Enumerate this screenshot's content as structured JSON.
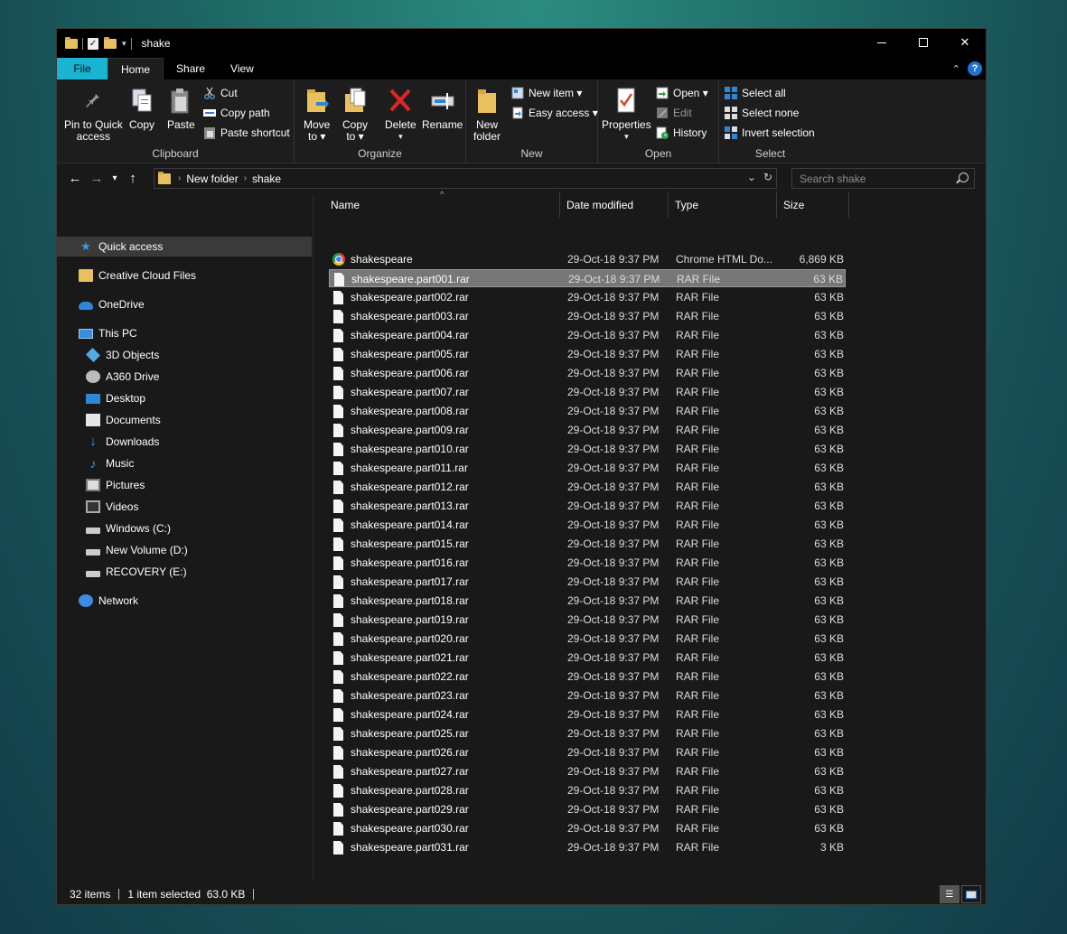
{
  "window": {
    "title": "shake",
    "controls": {
      "minimize": "minimize",
      "maximize": "maximize",
      "close": "✕"
    }
  },
  "ribbon_tabs": [
    {
      "label": "File"
    },
    {
      "label": "Home"
    },
    {
      "label": "Share"
    },
    {
      "label": "View"
    }
  ],
  "ribbon": {
    "clipboard": {
      "label": "Clipboard",
      "pin_line1": "Pin to Quick",
      "pin_line2": "access",
      "copy": "Copy",
      "paste": "Paste",
      "cut": "Cut",
      "copy_path": "Copy path",
      "paste_shortcut": "Paste shortcut"
    },
    "organize": {
      "label": "Organize",
      "move_line1": "Move",
      "move_line2": "to ▾",
      "copyto_line1": "Copy",
      "copyto_line2": "to ▾",
      "delete": "Delete",
      "delete_caret": "▾",
      "rename": "Rename"
    },
    "new": {
      "label": "New",
      "folder_line1": "New",
      "folder_line2": "folder",
      "new_item": "New item ▾",
      "easy_access": "Easy access ▾"
    },
    "open": {
      "label": "Open",
      "properties": "Properties",
      "properties_caret": "▾",
      "open": "Open ▾",
      "edit": "Edit",
      "history": "History"
    },
    "select": {
      "label": "Select",
      "select_all": "Select all",
      "select_none": "Select none",
      "invert": "Invert selection"
    }
  },
  "address": {
    "crumbs": [
      "New folder",
      "shake"
    ],
    "search_placeholder": "Search shake"
  },
  "nav_pane": [
    {
      "label": "Quick access",
      "icon": "star-icon",
      "selected": true
    },
    {
      "label": "Creative Cloud Files",
      "icon": "creative-cloud-icon"
    },
    {
      "label": "OneDrive",
      "icon": "cloud-icon"
    },
    {
      "label": "This PC",
      "icon": "computer-icon"
    },
    {
      "label": "3D Objects",
      "icon": "cube-icon"
    },
    {
      "label": "A360 Drive",
      "icon": "a360-drive-icon"
    },
    {
      "label": "Desktop",
      "icon": "desktop-icon"
    },
    {
      "label": "Documents",
      "icon": "documents-icon"
    },
    {
      "label": "Downloads",
      "icon": "download-arrow-icon"
    },
    {
      "label": "Music",
      "icon": "music-note-icon"
    },
    {
      "label": "Pictures",
      "icon": "pictures-icon"
    },
    {
      "label": "Videos",
      "icon": "videos-icon"
    },
    {
      "label": "Windows (C:)",
      "icon": "drive-icon"
    },
    {
      "label": "New Volume (D:)",
      "icon": "drive-icon"
    },
    {
      "label": "RECOVERY (E:)",
      "icon": "drive-icon"
    },
    {
      "label": "Network",
      "icon": "network-icon"
    }
  ],
  "columns": {
    "name": "Name",
    "date": "Date modified",
    "type": "Type",
    "size": "Size"
  },
  "files": [
    {
      "name": "shakespeare",
      "date": "29-Oct-18 9:37 PM",
      "type": "Chrome HTML Do...",
      "size": "6,869 KB",
      "icon": "chrome-icon"
    },
    {
      "name": "shakespeare.part001.rar",
      "date": "29-Oct-18 9:37 PM",
      "type": "RAR File",
      "size": "63 KB",
      "selected": true
    },
    {
      "name": "shakespeare.part002.rar",
      "date": "29-Oct-18 9:37 PM",
      "type": "RAR File",
      "size": "63 KB"
    },
    {
      "name": "shakespeare.part003.rar",
      "date": "29-Oct-18 9:37 PM",
      "type": "RAR File",
      "size": "63 KB"
    },
    {
      "name": "shakespeare.part004.rar",
      "date": "29-Oct-18 9:37 PM",
      "type": "RAR File",
      "size": "63 KB"
    },
    {
      "name": "shakespeare.part005.rar",
      "date": "29-Oct-18 9:37 PM",
      "type": "RAR File",
      "size": "63 KB"
    },
    {
      "name": "shakespeare.part006.rar",
      "date": "29-Oct-18 9:37 PM",
      "type": "RAR File",
      "size": "63 KB"
    },
    {
      "name": "shakespeare.part007.rar",
      "date": "29-Oct-18 9:37 PM",
      "type": "RAR File",
      "size": "63 KB"
    },
    {
      "name": "shakespeare.part008.rar",
      "date": "29-Oct-18 9:37 PM",
      "type": "RAR File",
      "size": "63 KB"
    },
    {
      "name": "shakespeare.part009.rar",
      "date": "29-Oct-18 9:37 PM",
      "type": "RAR File",
      "size": "63 KB"
    },
    {
      "name": "shakespeare.part010.rar",
      "date": "29-Oct-18 9:37 PM",
      "type": "RAR File",
      "size": "63 KB"
    },
    {
      "name": "shakespeare.part011.rar",
      "date": "29-Oct-18 9:37 PM",
      "type": "RAR File",
      "size": "63 KB"
    },
    {
      "name": "shakespeare.part012.rar",
      "date": "29-Oct-18 9:37 PM",
      "type": "RAR File",
      "size": "63 KB"
    },
    {
      "name": "shakespeare.part013.rar",
      "date": "29-Oct-18 9:37 PM",
      "type": "RAR File",
      "size": "63 KB"
    },
    {
      "name": "shakespeare.part014.rar",
      "date": "29-Oct-18 9:37 PM",
      "type": "RAR File",
      "size": "63 KB"
    },
    {
      "name": "shakespeare.part015.rar",
      "date": "29-Oct-18 9:37 PM",
      "type": "RAR File",
      "size": "63 KB"
    },
    {
      "name": "shakespeare.part016.rar",
      "date": "29-Oct-18 9:37 PM",
      "type": "RAR File",
      "size": "63 KB"
    },
    {
      "name": "shakespeare.part017.rar",
      "date": "29-Oct-18 9:37 PM",
      "type": "RAR File",
      "size": "63 KB"
    },
    {
      "name": "shakespeare.part018.rar",
      "date": "29-Oct-18 9:37 PM",
      "type": "RAR File",
      "size": "63 KB"
    },
    {
      "name": "shakespeare.part019.rar",
      "date": "29-Oct-18 9:37 PM",
      "type": "RAR File",
      "size": "63 KB"
    },
    {
      "name": "shakespeare.part020.rar",
      "date": "29-Oct-18 9:37 PM",
      "type": "RAR File",
      "size": "63 KB"
    },
    {
      "name": "shakespeare.part021.rar",
      "date": "29-Oct-18 9:37 PM",
      "type": "RAR File",
      "size": "63 KB"
    },
    {
      "name": "shakespeare.part022.rar",
      "date": "29-Oct-18 9:37 PM",
      "type": "RAR File",
      "size": "63 KB"
    },
    {
      "name": "shakespeare.part023.rar",
      "date": "29-Oct-18 9:37 PM",
      "type": "RAR File",
      "size": "63 KB"
    },
    {
      "name": "shakespeare.part024.rar",
      "date": "29-Oct-18 9:37 PM",
      "type": "RAR File",
      "size": "63 KB"
    },
    {
      "name": "shakespeare.part025.rar",
      "date": "29-Oct-18 9:37 PM",
      "type": "RAR File",
      "size": "63 KB"
    },
    {
      "name": "shakespeare.part026.rar",
      "date": "29-Oct-18 9:37 PM",
      "type": "RAR File",
      "size": "63 KB"
    },
    {
      "name": "shakespeare.part027.rar",
      "date": "29-Oct-18 9:37 PM",
      "type": "RAR File",
      "size": "63 KB"
    },
    {
      "name": "shakespeare.part028.rar",
      "date": "29-Oct-18 9:37 PM",
      "type": "RAR File",
      "size": "63 KB"
    },
    {
      "name": "shakespeare.part029.rar",
      "date": "29-Oct-18 9:37 PM",
      "type": "RAR File",
      "size": "63 KB"
    },
    {
      "name": "shakespeare.part030.rar",
      "date": "29-Oct-18 9:37 PM",
      "type": "RAR File",
      "size": "63 KB"
    },
    {
      "name": "shakespeare.part031.rar",
      "date": "29-Oct-18 9:37 PM",
      "type": "RAR File",
      "size": "3 KB"
    }
  ],
  "status": {
    "items": "32 items",
    "selected": "1 item selected  63.0 KB"
  },
  "colors": {
    "file_tab": "#1ab3d2",
    "selection": "#777777",
    "background": "#191919"
  }
}
